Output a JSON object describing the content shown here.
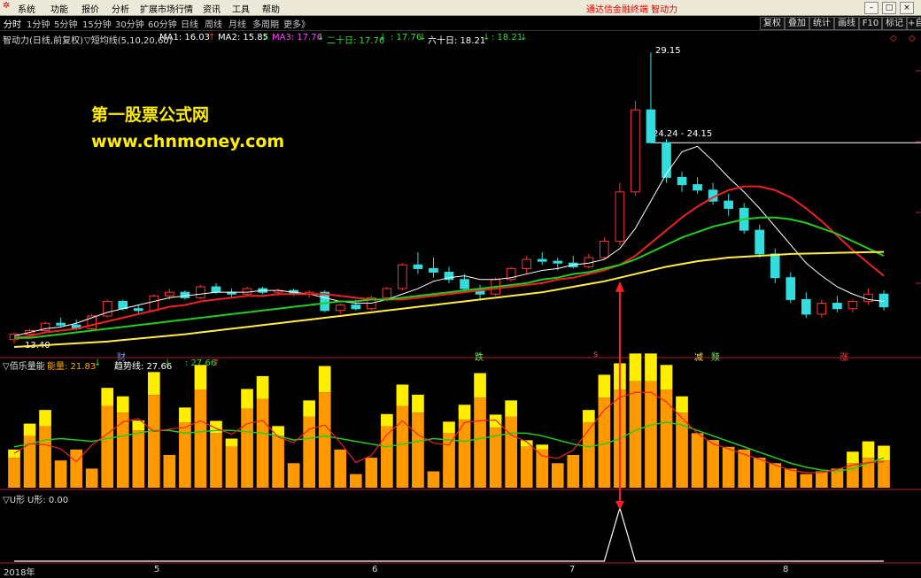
{
  "menu": {
    "logo_icon": "app-logo-icon",
    "items": [
      "系统",
      "功能",
      "报价",
      "分析",
      "扩展市场行情",
      "资讯",
      "工具",
      "帮助"
    ],
    "promo_text": "通达信金融终端 智动力"
  },
  "period_bar": {
    "items": [
      "分时",
      "1分钟",
      "5分钟",
      "15分钟",
      "30分钟",
      "60分钟",
      "日线",
      "周线",
      "月线",
      "多周期",
      "更多》"
    ],
    "active": "分时",
    "right_buttons": [
      "复权",
      "叠加",
      "统计",
      "画线",
      "F10",
      "标记",
      "+自"
    ]
  },
  "main_chart": {
    "title": "智动力(日线,前复权)",
    "indicator": "▽短均线(5,10,20,60)",
    "ma_labels": [
      {
        "text": "MA1: 16.03",
        "arrow": "↑",
        "color": "#ffffff"
      },
      {
        "text": "MA2: 15.85",
        "arrow": "↓",
        "color": "#ffffff"
      },
      {
        "text": "MA3: 17.76",
        "arrow": "↓",
        "color": "#ff44ff"
      },
      {
        "text": "二十日: 17.76",
        "arrow": "↓",
        "color": "#33dd33"
      },
      {
        "text": ": 17.76",
        "arrow": "↓",
        "color": "#33dd33"
      },
      {
        "text": "六十日: 18.21",
        "arrow": "↓",
        "color": "#ffffff"
      },
      {
        "text": ": 18.21",
        "arrow": "↓",
        "color": "#33dd33"
      }
    ],
    "watermark_line1": "第一股票公式网",
    "watermark_line2": "www.chnmoney.com",
    "high_label": "29.15",
    "level_label": "24.24 - 24.15",
    "low_label": "13.40",
    "event_markers": [
      {
        "text": "财",
        "color": "#6699ff"
      },
      {
        "text": "跌",
        "color": "#66ff66"
      },
      {
        "text": "s",
        "color": "#ff4444"
      },
      {
        "text": "减",
        "color": "#ffee44"
      },
      {
        "text": "赎",
        "color": "#66ff66"
      },
      {
        "text": "涨",
        "color": "#ff4444"
      }
    ]
  },
  "volume_panel": {
    "title": "▽佰乐量能",
    "energy_label": "能量: 21.83",
    "energy_arrow": "↓",
    "trend_label": "趋势线: 27.66",
    "trend_arrow": "↓",
    "trend_value2": ": 27.66",
    "trend_arrow2": "↑"
  },
  "u_panel": {
    "title": "▽U形",
    "value_label": "U形: 0.00"
  },
  "time_axis": {
    "labels": [
      "2018年",
      "5",
      "6",
      "7",
      "8"
    ]
  },
  "colors": {
    "up_candle": "#ff3333",
    "down_candle": "#33dddd",
    "ma_white": "#ffffff",
    "ma_red": "#ee2222",
    "ma_green": "#22cc22",
    "ma_yellow": "#ffee44",
    "vol_orange": "#ff9900",
    "vol_yellow": "#ffee00",
    "watermark": "#ffee00",
    "signal_red": "#ff2222"
  },
  "chart_data": [
    {
      "type": "candlestick",
      "series": [
        {
          "name": "K线",
          "values": [
            [
              13.4,
              13.8,
              13.2,
              13.7
            ],
            [
              13.7,
              14.0,
              13.5,
              13.9
            ],
            [
              13.9,
              14.4,
              13.8,
              14.3
            ],
            [
              14.3,
              14.6,
              14.1,
              14.2
            ],
            [
              14.2,
              14.5,
              13.9,
              14.0
            ],
            [
              14.0,
              14.8,
              13.9,
              14.7
            ],
            [
              14.7,
              15.6,
              14.6,
              15.5
            ],
            [
              15.5,
              15.6,
              15.0,
              15.1
            ],
            [
              15.1,
              15.3,
              14.8,
              15.0
            ],
            [
              15.0,
              15.9,
              14.9,
              15.8
            ],
            [
              15.8,
              16.2,
              15.6,
              16.0
            ],
            [
              16.0,
              16.1,
              15.6,
              15.7
            ],
            [
              15.7,
              16.4,
              15.6,
              16.3
            ],
            [
              16.3,
              16.5,
              15.9,
              16.0
            ],
            [
              16.0,
              16.2,
              15.7,
              15.9
            ],
            [
              15.9,
              16.3,
              15.8,
              16.2
            ],
            [
              16.2,
              16.3,
              15.9,
              16.0
            ],
            [
              16.0,
              16.2,
              15.8,
              16.1
            ],
            [
              16.1,
              16.2,
              15.8,
              15.9
            ],
            [
              15.9,
              16.1,
              15.7,
              16.0
            ],
            [
              16.0,
              16.1,
              14.9,
              15.0
            ],
            [
              15.0,
              15.4,
              14.8,
              15.3
            ],
            [
              15.3,
              15.6,
              15.0,
              15.1
            ],
            [
              15.1,
              15.8,
              15.0,
              15.7
            ],
            [
              15.7,
              16.3,
              15.5,
              16.2
            ],
            [
              16.2,
              17.6,
              16.1,
              17.5
            ],
            [
              17.5,
              18.2,
              17.0,
              17.3
            ],
            [
              17.3,
              17.9,
              16.8,
              17.1
            ],
            [
              17.1,
              17.4,
              16.5,
              16.7
            ],
            [
              16.7,
              17.0,
              16.0,
              16.2
            ],
            [
              16.2,
              16.4,
              15.6,
              15.9
            ],
            [
              15.9,
              16.8,
              15.8,
              16.7
            ],
            [
              16.7,
              17.4,
              16.6,
              17.3
            ],
            [
              17.3,
              18.0,
              17.0,
              17.8
            ],
            [
              17.8,
              18.2,
              17.5,
              17.7
            ],
            [
              17.7,
              17.9,
              17.2,
              17.6
            ],
            [
              17.6,
              18.0,
              17.3,
              17.4
            ],
            [
              17.4,
              18.1,
              17.3,
              17.9
            ],
            [
              17.9,
              19.0,
              17.8,
              18.8
            ],
            [
              18.8,
              22.0,
              18.6,
              21.5
            ],
            [
              21.5,
              26.5,
              21.3,
              26.0
            ],
            [
              26.0,
              29.15,
              25.8,
              24.2
            ],
            [
              24.2,
              24.4,
              22.0,
              22.3
            ],
            [
              22.3,
              22.6,
              21.5,
              21.9
            ],
            [
              21.9,
              22.3,
              21.4,
              21.6
            ],
            [
              21.6,
              22.0,
              20.8,
              21.0
            ],
            [
              21.0,
              21.4,
              20.2,
              20.6
            ],
            [
              20.6,
              20.9,
              19.2,
              19.4
            ],
            [
              19.4,
              19.7,
              17.9,
              18.1
            ],
            [
              18.1,
              18.4,
              16.5,
              16.8
            ],
            [
              16.8,
              17.1,
              15.4,
              15.6
            ],
            [
              15.6,
              16.0,
              14.6,
              14.8
            ],
            [
              14.8,
              15.6,
              14.6,
              15.4
            ],
            [
              15.4,
              15.8,
              14.9,
              15.1
            ],
            [
              15.1,
              15.6,
              14.9,
              15.5
            ],
            [
              15.5,
              16.2,
              15.3,
              15.9
            ],
            [
              15.9,
              16.1,
              15.0,
              15.2
            ]
          ]
        },
        {
          "name": "MA1",
          "values": [
            13.6,
            13.8,
            14.0,
            14.1,
            14.3,
            14.6,
            14.9,
            15.1,
            15.3,
            15.5,
            15.7,
            15.8,
            15.9,
            16.0,
            16.0,
            16.0,
            16.1,
            16.1,
            16.0,
            15.9,
            15.7,
            15.5,
            15.4,
            15.4,
            15.6,
            15.9,
            16.2,
            16.6,
            16.8,
            16.9,
            16.7,
            16.7,
            16.8,
            17.0,
            17.2,
            17.3,
            17.5,
            17.6,
            17.8,
            18.4,
            19.5,
            21.0,
            22.5,
            23.7,
            24.0,
            23.2,
            22.3,
            21.5,
            20.6,
            19.6,
            18.6,
            17.6,
            16.9,
            16.3,
            15.9,
            15.6,
            15.5
          ]
        },
        {
          "name": "MA2",
          "values": [
            13.5,
            13.6,
            13.8,
            13.9,
            14.0,
            14.2,
            14.4,
            14.6,
            14.8,
            15.0,
            15.2,
            15.3,
            15.5,
            15.6,
            15.7,
            15.8,
            15.8,
            15.9,
            15.9,
            15.9,
            15.9,
            15.8,
            15.7,
            15.6,
            15.6,
            15.6,
            15.7,
            15.8,
            15.9,
            16.0,
            16.1,
            16.2,
            16.3,
            16.4,
            16.5,
            16.7,
            16.8,
            17.0,
            17.2,
            17.5,
            18.0,
            18.7,
            19.4,
            20.1,
            20.7,
            21.2,
            21.6,
            21.8,
            21.8,
            21.6,
            21.2,
            20.6,
            19.9,
            19.1,
            18.3,
            17.6,
            16.9
          ]
        },
        {
          "name": "MA3",
          "values": [
            13.5,
            13.5,
            13.6,
            13.7,
            13.8,
            13.9,
            14.0,
            14.1,
            14.2,
            14.3,
            14.4,
            14.5,
            14.6,
            14.7,
            14.8,
            14.9,
            15.0,
            15.1,
            15.2,
            15.3,
            15.4,
            15.5,
            15.5,
            15.6,
            15.6,
            15.7,
            15.8,
            15.9,
            16.0,
            16.1,
            16.2,
            16.3,
            16.4,
            16.5,
            16.7,
            16.8,
            17.0,
            17.1,
            17.3,
            17.5,
            17.8,
            18.2,
            18.6,
            19.0,
            19.3,
            19.6,
            19.8,
            20.0,
            20.1,
            20.1,
            20.0,
            19.8,
            19.5,
            19.2,
            18.8,
            18.4,
            18.0
          ]
        },
        {
          "name": "MA4",
          "values": [
            13.0,
            13.05,
            13.1,
            13.15,
            13.2,
            13.25,
            13.3,
            13.38,
            13.46,
            13.54,
            13.62,
            13.7,
            13.8,
            13.9,
            14.0,
            14.1,
            14.2,
            14.3,
            14.4,
            14.5,
            14.6,
            14.7,
            14.8,
            14.9,
            15.0,
            15.1,
            15.2,
            15.3,
            15.4,
            15.5,
            15.6,
            15.7,
            15.8,
            15.9,
            16.0,
            16.15,
            16.3,
            16.45,
            16.6,
            16.8,
            17.0,
            17.2,
            17.4,
            17.55,
            17.7,
            17.8,
            17.9,
            17.95,
            18.0,
            18.05,
            18.1,
            18.12,
            18.14,
            18.16,
            18.18,
            18.2,
            18.21
          ]
        }
      ],
      "ylim": [
        13.0,
        29.5
      ]
    },
    {
      "type": "bar",
      "series": [
        {
          "name": "能量",
          "values": [
            22,
            38,
            45,
            20,
            28,
            14,
            60,
            55,
            42,
            68,
            24,
            48,
            72,
            40,
            30,
            58,
            65,
            38,
            18,
            52,
            70,
            28,
            10,
            22,
            45,
            60,
            55,
            12,
            40,
            50,
            66,
            44,
            52,
            30,
            28,
            18,
            24,
            48,
            66,
            72,
            78,
            78,
            72,
            55,
            40,
            35,
            30,
            28,
            22,
            18,
            14,
            10,
            12,
            14,
            18,
            22,
            20
          ]
        },
        {
          "name": "量能上部",
          "values": [
            10,
            15,
            20,
            0,
            0,
            0,
            22,
            20,
            12,
            28,
            0,
            18,
            30,
            15,
            10,
            24,
            28,
            12,
            0,
            20,
            32,
            0,
            0,
            0,
            15,
            26,
            22,
            0,
            14,
            18,
            30,
            16,
            20,
            8,
            6,
            0,
            0,
            15,
            28,
            32,
            34,
            34,
            30,
            20,
            0,
            0,
            0,
            0,
            0,
            0,
            0,
            0,
            0,
            0,
            14,
            20,
            18
          ]
        },
        {
          "name": "趋势线",
          "values": [
            30,
            32,
            35,
            36,
            35,
            34,
            36,
            38,
            40,
            42,
            42,
            40,
            41,
            42,
            42,
            41,
            40,
            38,
            35,
            36,
            38,
            36,
            34,
            32,
            30,
            32,
            34,
            36,
            35,
            34,
            36,
            38,
            40,
            40,
            38,
            35,
            32,
            30,
            32,
            36,
            42,
            46,
            48,
            46,
            42,
            38,
            34,
            30,
            26,
            22,
            18,
            15,
            13,
            12,
            14,
            18,
            21.83
          ]
        }
      ],
      "ylim": [
        0,
        85
      ]
    },
    {
      "type": "line",
      "series": [
        {
          "name": "U形",
          "values": [
            0,
            0,
            0,
            0,
            0,
            0,
            0,
            0,
            0,
            0,
            0,
            0,
            0,
            0,
            0,
            0,
            0,
            0,
            0,
            0,
            0,
            0,
            0,
            0,
            0,
            0,
            0,
            0,
            0,
            0,
            0,
            0,
            0,
            0,
            0,
            0,
            0,
            0,
            0,
            1,
            0,
            0,
            0,
            0,
            0,
            0,
            0,
            0,
            0,
            0,
            0,
            0,
            0,
            0,
            0,
            0,
            0
          ]
        }
      ],
      "ylim": [
        0,
        1
      ]
    }
  ]
}
